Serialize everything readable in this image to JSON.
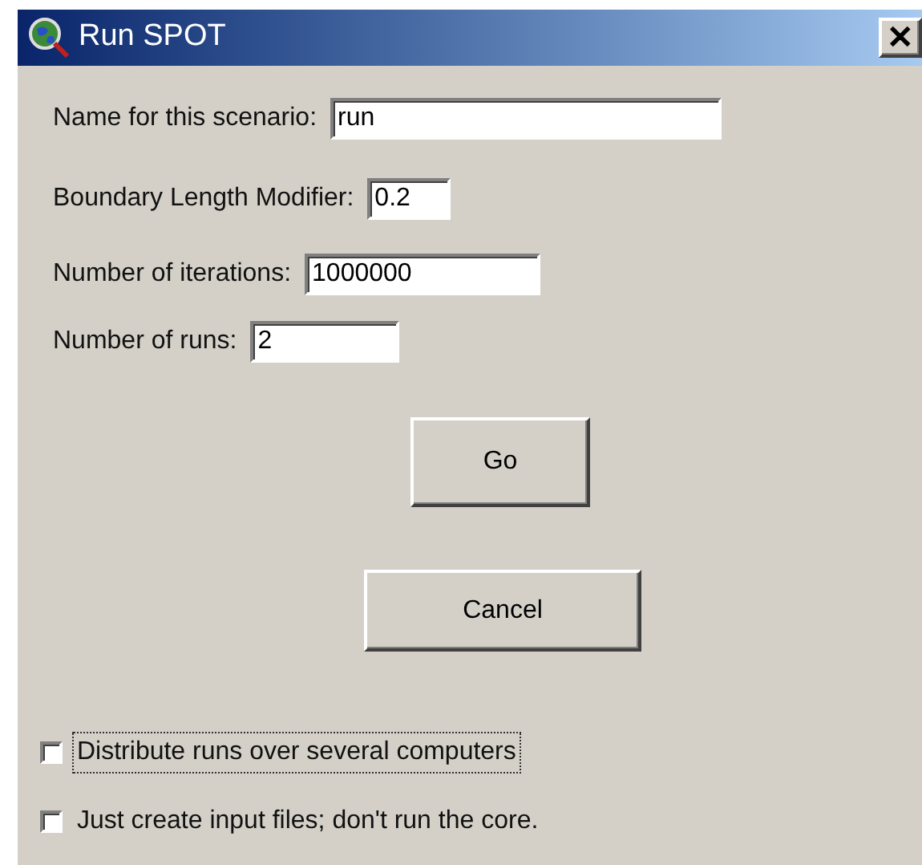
{
  "window": {
    "title": "Run SPOT",
    "close": "✕"
  },
  "fields": [
    {
      "label": "Name for this scenario:",
      "value": "run"
    },
    {
      "label": "Boundary Length Modifier:",
      "value": "0.2"
    },
    {
      "label": "Number of iterations:",
      "value": "1000000"
    },
    {
      "label": "Number of runs:",
      "value": "2"
    }
  ],
  "buttons": [
    "Go",
    "Cancel"
  ],
  "checkboxes": [
    {
      "label": "Distribute runs over several computers",
      "checked": false,
      "focused": true
    },
    {
      "label": "Just create input files; don't run the core.",
      "checked": false,
      "focused": false
    }
  ]
}
